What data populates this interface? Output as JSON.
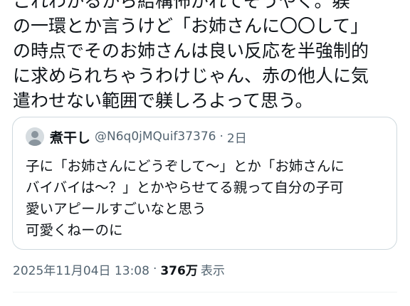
{
  "tweet": {
    "lines": [
      "これわかるから結構怖がれてそうやく。躾",
      "の一環とか言うけど「お姉さんに〇〇して」",
      "の時点でそのお姉さんは良い反応を半強制的",
      "に求められちゃうわけじゃん、赤の他人に気",
      "遣わせない範囲で躾しろよって思う。"
    ]
  },
  "quote": {
    "avatar_icon": "user-avatar-icon",
    "name": "煮干し",
    "handle": "@N6q0jMQuif37376",
    "separator": "·",
    "time": "2日",
    "lines": [
      "子に「お姉さんにどうぞして〜」とか「お姉さんに",
      "バイバイは〜？」とかやらせてる親って自分の子可",
      "愛いアピールすごいなと思う",
      "可愛くねーのに"
    ]
  },
  "meta": {
    "timestamp": "2025年11月04日 13:08",
    "separator": "·",
    "views_count": "376万",
    "views_label": "表示"
  }
}
